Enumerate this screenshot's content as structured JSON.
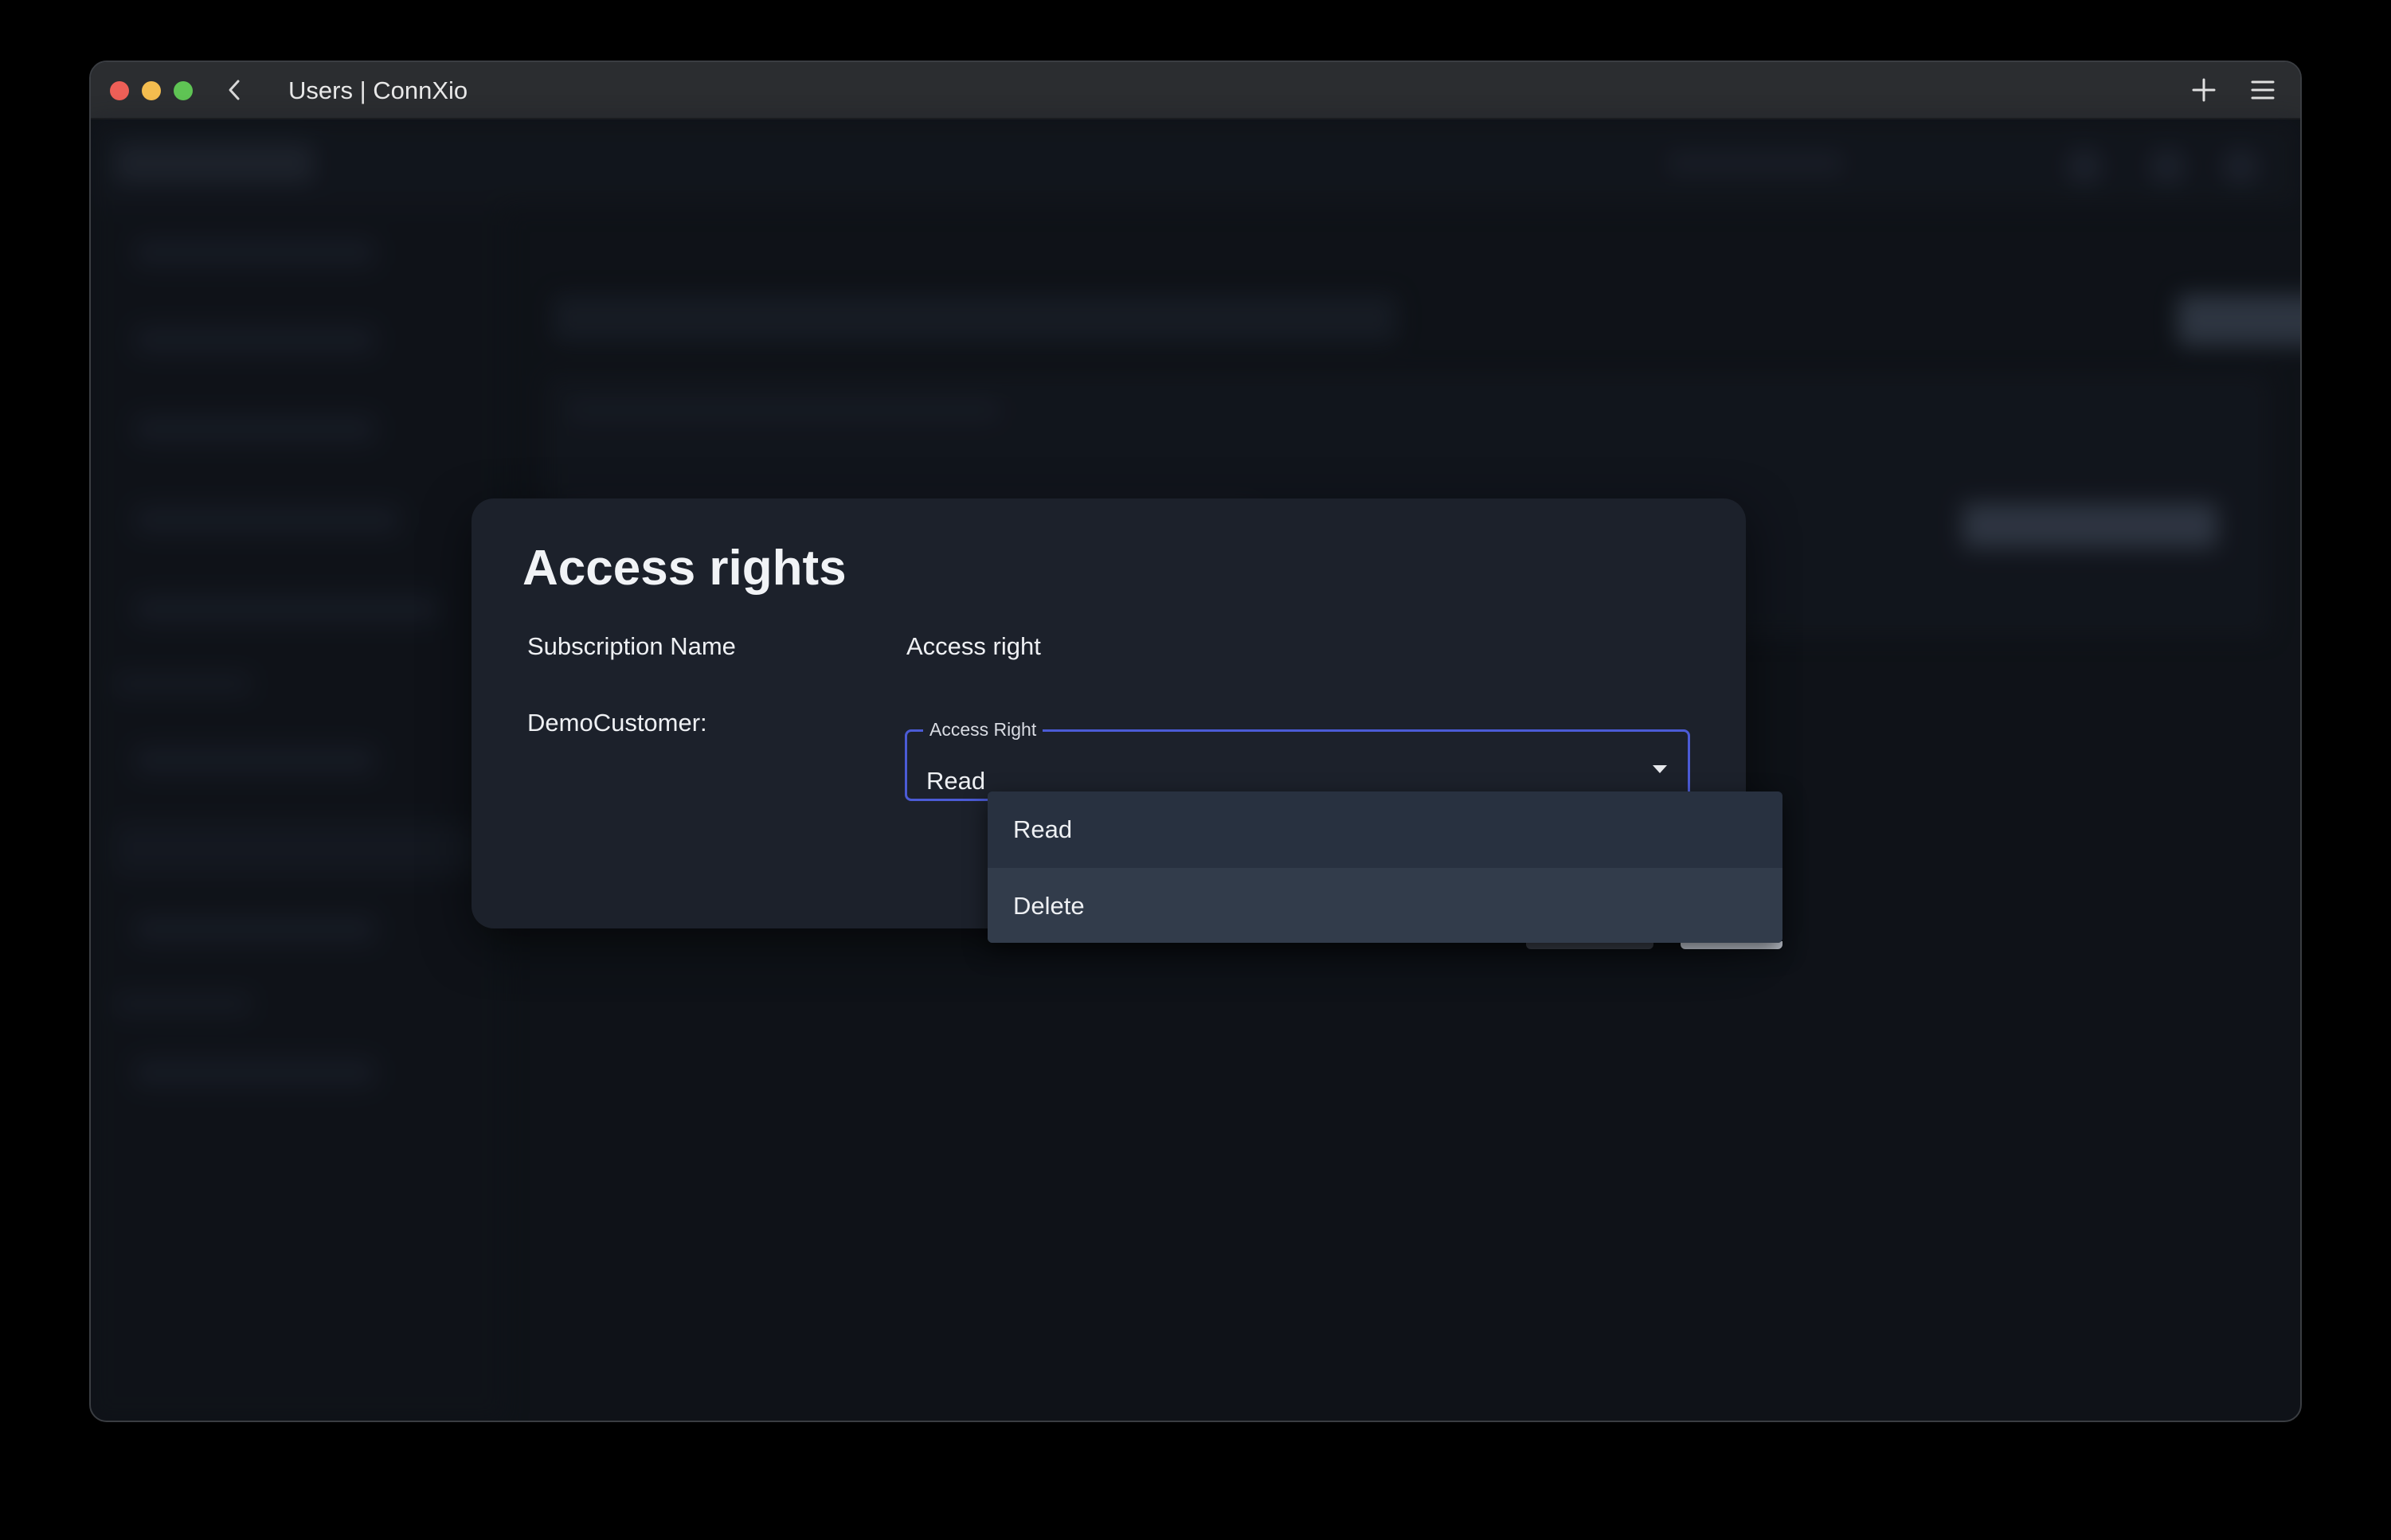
{
  "window": {
    "title": "Users | ConnXio"
  },
  "modal": {
    "title": "Access rights",
    "columns": {
      "subscription_header": "Subscription Name",
      "access_header": "Access right"
    },
    "row": {
      "subscription_name": "DemoCustomer:"
    },
    "select": {
      "legend": "Access Right",
      "value": "Read"
    }
  },
  "dropdown": {
    "options": [
      {
        "label": "Read"
      },
      {
        "label": "Delete"
      }
    ],
    "highlighted": "Delete"
  },
  "colors": {
    "focus_border": "#4b5bd6",
    "modal_bg": "#1c212b",
    "menu_bg": "#283140",
    "menu_hover": "#323c4b"
  }
}
